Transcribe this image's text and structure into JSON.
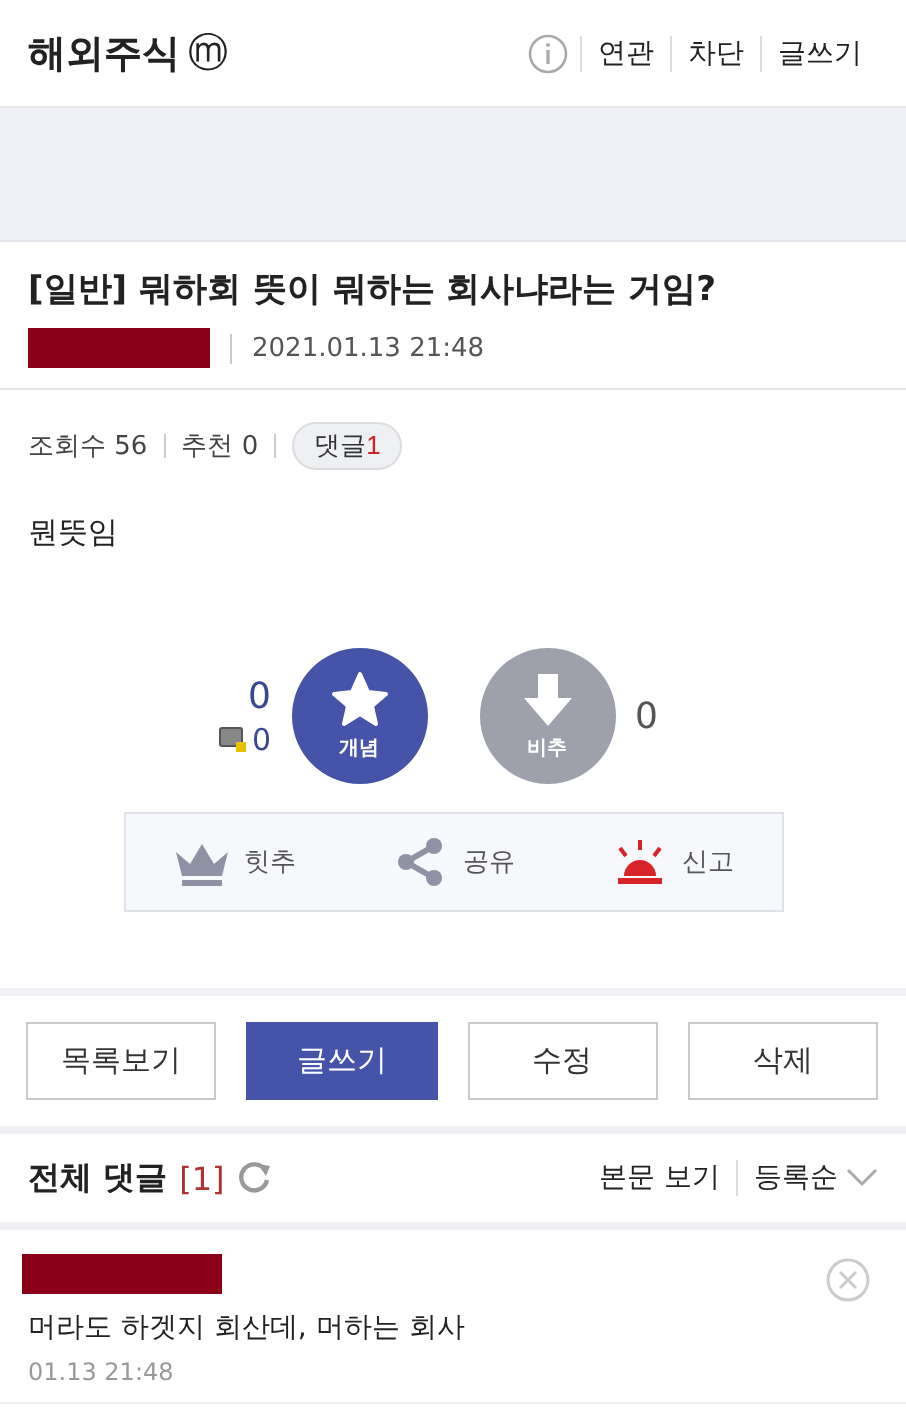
{
  "header": {
    "title": "해외주식",
    "badge": "ⓜ",
    "links": [
      "연관",
      "차단",
      "글쓰기"
    ]
  },
  "post": {
    "title": "[일반] 뭐하회 뜻이 뭐하는 회사냐라는 거임?",
    "date": "2021.01.13 21:48",
    "views": "조회수 56",
    "recommend": "추천 0",
    "comment_label": "댓글",
    "comment_count": "1",
    "body": "뭔뜻임"
  },
  "votes": {
    "up_count": "0",
    "up_fixed_count": "0",
    "up_label": "개념",
    "down_label": "비추",
    "down_count": "0"
  },
  "actions": [
    {
      "kind": "crown",
      "label": "힛추"
    },
    {
      "kind": "share",
      "label": "공유"
    },
    {
      "kind": "siren",
      "label": "신고"
    }
  ],
  "buttons": [
    {
      "label": "목록보기",
      "primary": false
    },
    {
      "label": "글쓰기",
      "primary": true
    },
    {
      "label": "수정",
      "primary": false
    },
    {
      "label": "삭제",
      "primary": false
    }
  ],
  "comments_header": {
    "title": "전체 댓글",
    "count": "[1]",
    "view_body": "본문 보기",
    "sort": "등록순"
  },
  "comments": [
    {
      "text": "머라도 하겟지 회산데, 머하는 회사",
      "date": "01.13 21:48"
    }
  ]
}
